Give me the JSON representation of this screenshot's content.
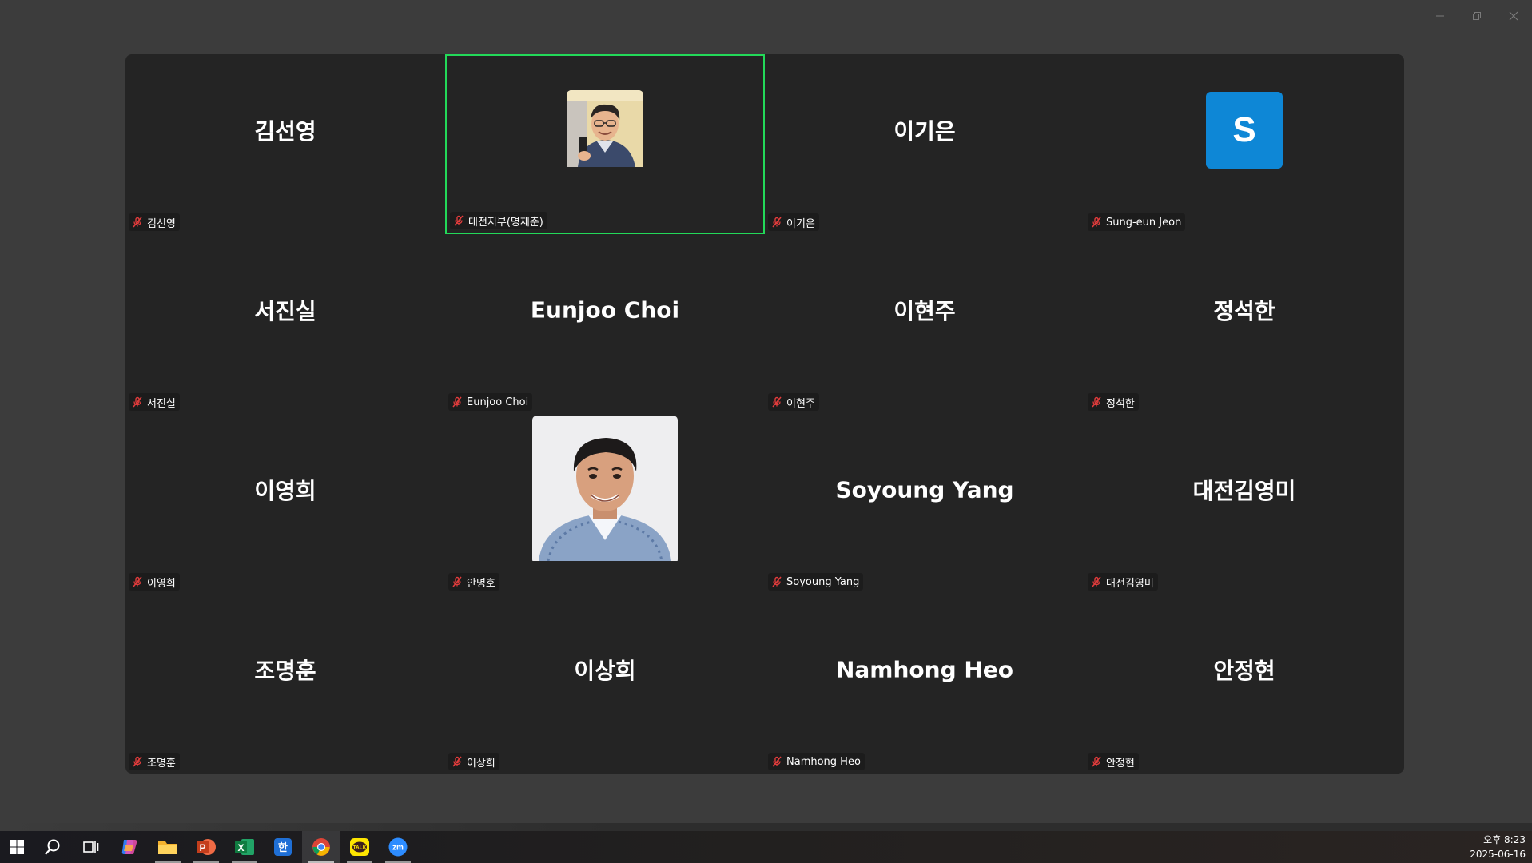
{
  "window": {
    "controls": [
      {
        "name": "minimize-button",
        "icon": "minimize-icon"
      },
      {
        "name": "restore-button",
        "icon": "restore-icon"
      },
      {
        "name": "close-button",
        "icon": "close-icon"
      }
    ]
  },
  "gallery": {
    "active_speaker_color": "#23d959",
    "mute_icon_color": "#e23c3c",
    "participants": [
      {
        "display": "김선영",
        "label": "김선영",
        "muted": true,
        "active": false,
        "avatar": "name"
      },
      {
        "display": "",
        "label": "대전지부(명재춘)",
        "muted": true,
        "active": true,
        "avatar": "photo-small"
      },
      {
        "display": "이기은",
        "label": "이기은",
        "muted": true,
        "active": false,
        "avatar": "name"
      },
      {
        "display": "S",
        "label": "Sung-eun Jeon",
        "muted": true,
        "active": false,
        "avatar": "letter",
        "avatar_color": "#0e87d6"
      },
      {
        "display": "서진실",
        "label": "서진실",
        "muted": true,
        "active": false,
        "avatar": "name"
      },
      {
        "display": "Eunjoo Choi",
        "label": "Eunjoo Choi",
        "muted": true,
        "active": false,
        "avatar": "name"
      },
      {
        "display": "이현주",
        "label": "이현주",
        "muted": true,
        "active": false,
        "avatar": "name"
      },
      {
        "display": "정석한",
        "label": "정석한",
        "muted": true,
        "active": false,
        "avatar": "name"
      },
      {
        "display": "이영희",
        "label": "이영희",
        "muted": true,
        "active": false,
        "avatar": "name"
      },
      {
        "display": "",
        "label": "안명호",
        "muted": true,
        "active": false,
        "avatar": "photo-large"
      },
      {
        "display": "Soyoung Yang",
        "label": "Soyoung Yang",
        "muted": true,
        "active": false,
        "avatar": "name"
      },
      {
        "display": "대전김영미",
        "label": "대전김영미",
        "muted": true,
        "active": false,
        "avatar": "name"
      },
      {
        "display": "조명훈",
        "label": "조명훈",
        "muted": true,
        "active": false,
        "avatar": "name"
      },
      {
        "display": "이상희",
        "label": "이상희",
        "muted": true,
        "active": false,
        "avatar": "name"
      },
      {
        "display": "Namhong Heo",
        "label": "Namhong Heo",
        "muted": true,
        "active": false,
        "avatar": "name"
      },
      {
        "display": "안정현",
        "label": "안정현",
        "muted": true,
        "active": false,
        "avatar": "name"
      }
    ]
  },
  "taskbar": {
    "apps": [
      {
        "name": "start",
        "icon": "windows-logo-icon",
        "running": false,
        "selected": false
      },
      {
        "name": "search",
        "icon": "search-icon",
        "running": false,
        "selected": false
      },
      {
        "name": "task-view",
        "icon": "task-view-icon",
        "running": false,
        "selected": false
      },
      {
        "name": "copilot",
        "icon": "copilot-icon",
        "running": false,
        "selected": false
      },
      {
        "name": "file-explorer",
        "icon": "folder-icon",
        "running": true,
        "selected": false
      },
      {
        "name": "powerpoint",
        "icon": "powerpoint-icon",
        "running": true,
        "selected": false
      },
      {
        "name": "excel",
        "icon": "excel-icon",
        "running": true,
        "selected": false
      },
      {
        "name": "hangul",
        "icon": "hangul-icon",
        "running": false,
        "selected": false
      },
      {
        "name": "chrome",
        "icon": "chrome-icon",
        "running": true,
        "selected": true
      },
      {
        "name": "kakaotalk",
        "icon": "kakaotalk-icon",
        "running": true,
        "selected": false
      },
      {
        "name": "zoom",
        "icon": "zoom-icon",
        "running": true,
        "selected": false
      }
    ],
    "hangul_glyph": "한",
    "kakaotalk_glyph": "TALK",
    "zoom_glyph": "zm",
    "powerpoint_glyph": "P",
    "excel_glyph": "X",
    "clock": {
      "time": "오후 8:23",
      "date": "2025-06-16"
    }
  }
}
